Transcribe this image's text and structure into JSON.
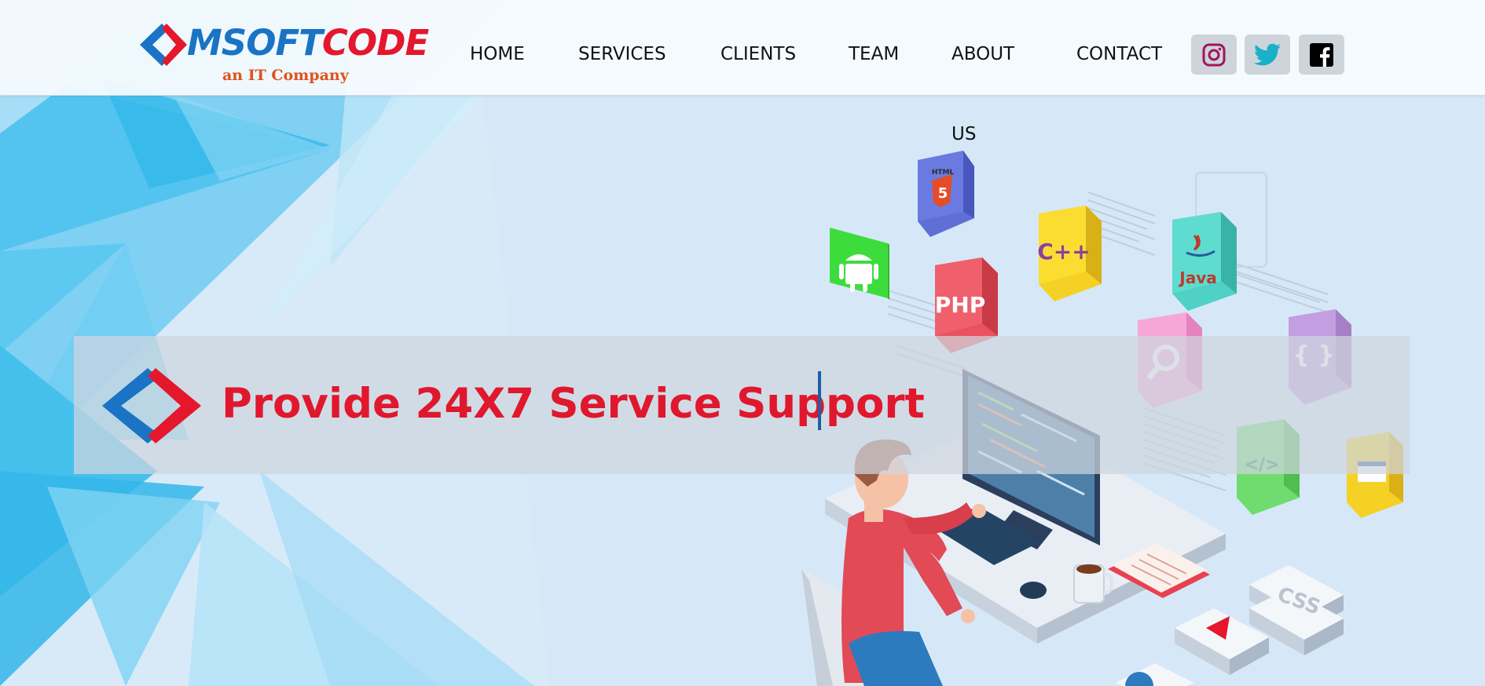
{
  "brand": {
    "name_part1": "MSOFT",
    "name_part2": "CODE",
    "tagline": "an IT Company",
    "primary_color": "#1a73c4",
    "accent_color": "#e4172d"
  },
  "nav": {
    "home": "HOME",
    "services": "SERVICES",
    "clients": "CLIENTS",
    "team": "TEAM",
    "about_line1": "ABOUT",
    "about_line2": "US",
    "contact": "CONTACT"
  },
  "social": [
    {
      "name": "instagram-icon",
      "color": "#a3155a"
    },
    {
      "name": "twitter-icon",
      "color": "#1ab0c9"
    },
    {
      "name": "facebook-icon",
      "color": "#000000"
    }
  ],
  "hero": {
    "headline": "Provide 24X7 Service Support",
    "text_color": "#e0172d"
  },
  "illustration": {
    "tiles": {
      "html": "HTML",
      "html_num": "5",
      "cpp": "C++",
      "java": "Java",
      "php": "PHP",
      "css": "CSS",
      "braces": "{ }",
      "code": "</>"
    }
  }
}
